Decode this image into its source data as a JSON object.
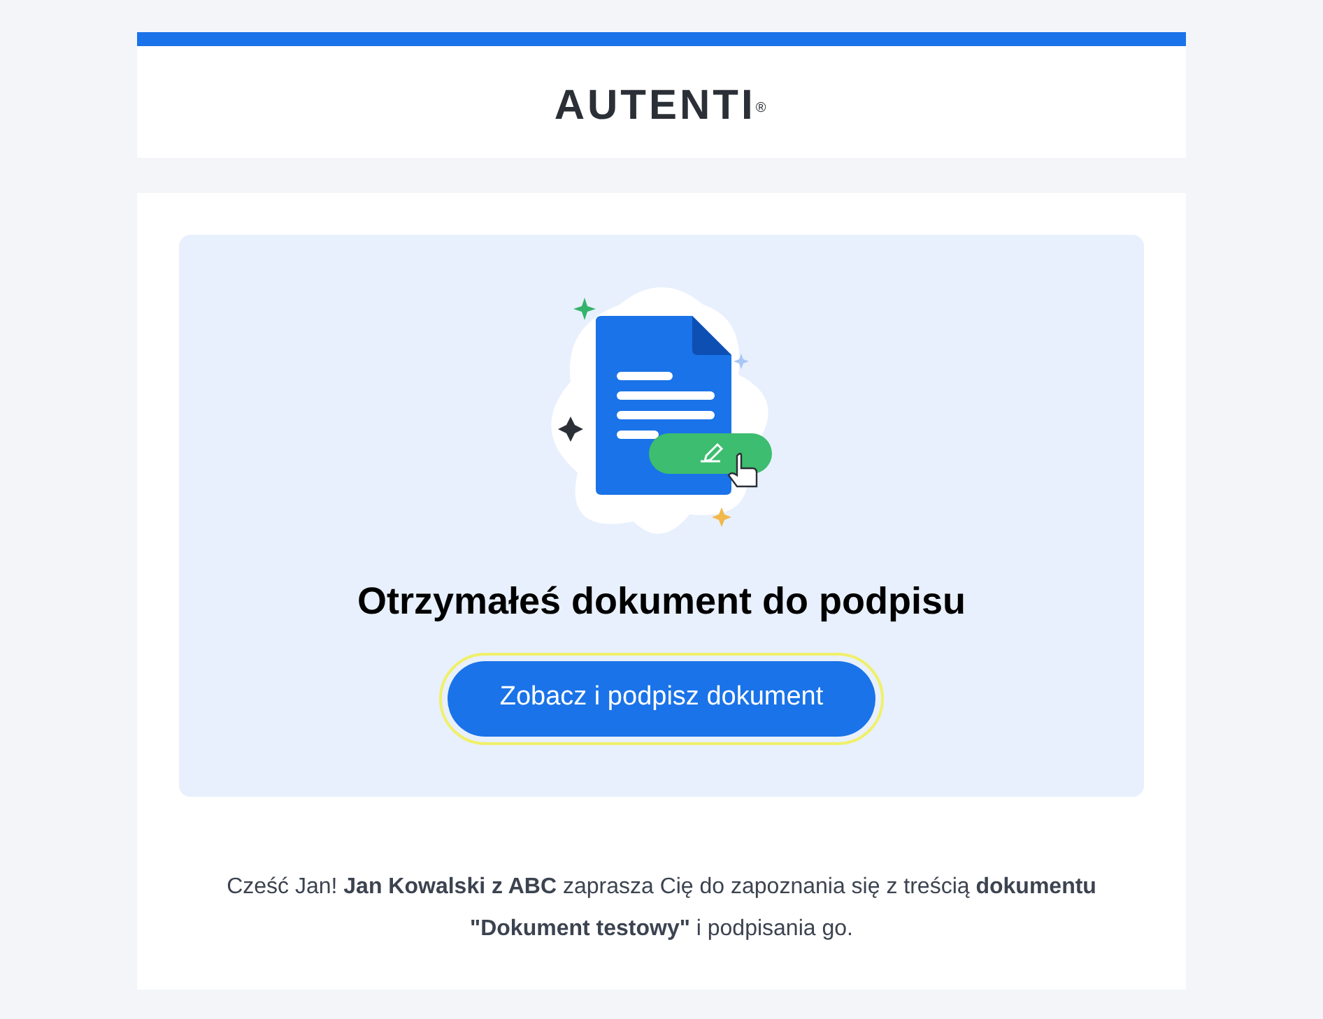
{
  "logo": {
    "text": "AUTENTI$^{®}$"
  },
  "hero": {
    "title": "Otrzymałeś dokument do podpisu",
    "button": {
      "label": "Zobacz i podpisz dokument",
      "focused": true
    }
  },
  "message": "Cześć Jan! **Jan Kowalski z ABC** zaprasza Cię do zapoznania się z treścią **dokumentu \"Dokument testowy\"** i podpisania go."
}
